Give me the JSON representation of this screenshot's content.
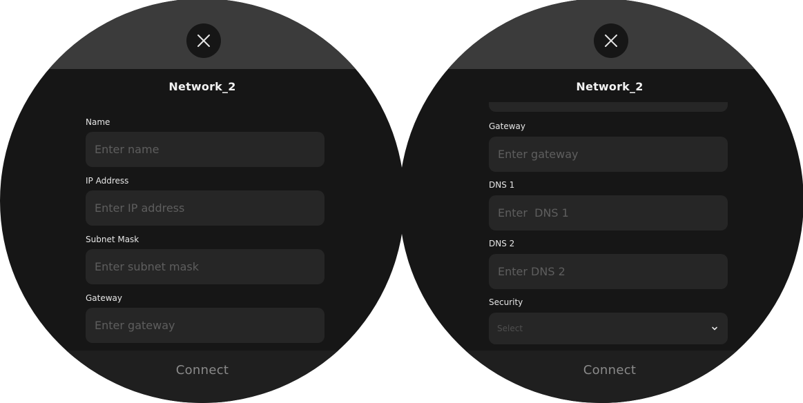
{
  "left_screen": {
    "title": "Network_2",
    "fields": [
      {
        "label": "Name",
        "placeholder": "Enter name"
      },
      {
        "label": "IP Address",
        "placeholder": "Enter IP address"
      },
      {
        "label": "Subnet Mask",
        "placeholder": "Enter subnet mask"
      },
      {
        "label": "Gateway",
        "placeholder": "Enter gateway"
      }
    ],
    "connect_label": "Connect"
  },
  "right_screen": {
    "title": "Network_2",
    "fields": [
      {
        "label": "Gateway",
        "placeholder": "Enter gateway"
      },
      {
        "label": "DNS 1",
        "placeholder": "Enter  DNS 1"
      },
      {
        "label": "DNS 2",
        "placeholder": "Enter DNS 2"
      }
    ],
    "security": {
      "label": "Security",
      "value": "Select"
    },
    "connect_label": "Connect"
  },
  "icons": {
    "close": "close-icon",
    "chevron": "chevron-down-icon"
  },
  "colors": {
    "screen_bg": "#161616",
    "header_bg": "#3b3b3b",
    "input_bg": "#262626",
    "label_text": "#e6e6e6",
    "placeholder_text": "#5e5e5e",
    "connect_text": "#8a8a8a"
  }
}
